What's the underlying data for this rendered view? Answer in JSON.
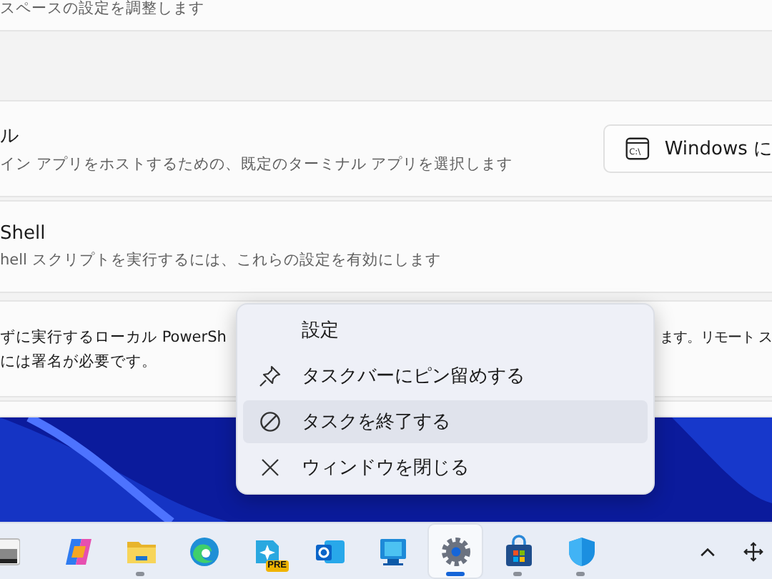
{
  "settings": {
    "top_description": "スペースの設定を調整します",
    "terminal": {
      "title": "ル",
      "description": "イン アプリをホストするための、既定のターミナル アプリを選択します",
      "dropdown_value": "Windows に",
      "icon_label": "C:\\"
    },
    "powershell": {
      "title": "Shell",
      "description": "hell スクリプトを実行するには、これらの設定を有効にします"
    },
    "execution_policy": {
      "line_1_left": "ずに実行するローカル PowerSh",
      "line_1_right": "ます。リモート ス",
      "line_2": "には署名が必要です。"
    }
  },
  "context_menu": {
    "items": [
      {
        "label": "設定",
        "kind": "plain",
        "highlighted": false
      },
      {
        "label": "タスクバーにピン留めする",
        "kind": "pin",
        "highlighted": false
      },
      {
        "label": "タスクを終了する",
        "kind": "end",
        "highlighted": true
      },
      {
        "label": "ウィンドウを閉じる",
        "kind": "close",
        "highlighted": false
      }
    ]
  },
  "taskbar": {
    "apps": [
      {
        "kind": "copilot",
        "running": false,
        "selected": false
      },
      {
        "kind": "folder",
        "running": true,
        "selected": false
      },
      {
        "kind": "edge",
        "running": false,
        "selected": false
      },
      {
        "kind": "preview",
        "badge": "PRE",
        "running": false,
        "selected": false
      },
      {
        "kind": "outlook",
        "running": false,
        "selected": false
      },
      {
        "kind": "monitor",
        "running": false,
        "selected": false
      },
      {
        "kind": "settings",
        "running": true,
        "selected": true
      },
      {
        "kind": "store",
        "running": true,
        "selected": false
      },
      {
        "kind": "shield",
        "running": true,
        "selected": false
      }
    ]
  }
}
